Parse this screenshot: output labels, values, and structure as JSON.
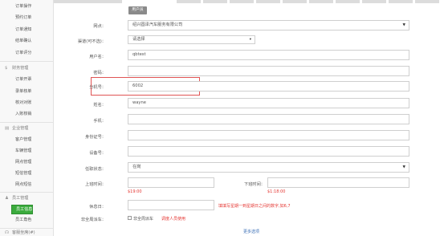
{
  "sidebar": {
    "group1_items": [
      {
        "label": "订单操作"
      },
      {
        "label": "预约订单"
      },
      {
        "label": "订单通知"
      },
      {
        "label": "结单确认"
      },
      {
        "label": "订单评分"
      }
    ],
    "finance": {
      "title": "财务管理",
      "icon": "dollar-icon",
      "items": [
        {
          "label": "订单开票"
        },
        {
          "label": "录单核单"
        },
        {
          "label": "核对对账"
        },
        {
          "label": "入账核销"
        }
      ]
    },
    "company": {
      "title": "企业管理",
      "icon": "building-icon",
      "items": [
        {
          "label": "客户管理"
        },
        {
          "label": "车辆管理"
        },
        {
          "label": "网点管理"
        },
        {
          "label": "短信管理"
        },
        {
          "label": "网点短信"
        }
      ]
    },
    "staff": {
      "title": "员工管理",
      "icon": "user-icon",
      "items": [
        {
          "label": "员工信息",
          "active": true
        },
        {
          "label": "员工角色"
        }
      ]
    },
    "bottom_partial": {
      "title": "客服坐席(#)"
    }
  },
  "header": {
    "button_label": "用户员"
  },
  "form": {
    "branch": {
      "label": "网点：",
      "value": "绍兴圆泽汽车服务有限公司"
    },
    "channel": {
      "label": "渠道(可不选)：",
      "value": "请选择"
    },
    "username": {
      "label": "用户名：",
      "value": "qbtest"
    },
    "password": {
      "label": "密码：",
      "value": ""
    },
    "extension": {
      "label": "分机号：",
      "value": "6002"
    },
    "name": {
      "label": "姓名：",
      "value": "wayne"
    },
    "phone": {
      "label": "手机：",
      "value": ""
    },
    "id_card": {
      "label": "身份证号：",
      "value": ""
    },
    "device": {
      "label": "设备号：",
      "value": ""
    },
    "status": {
      "label": "任职状态：",
      "value": "在岗"
    },
    "shift_start": {
      "label": "上班时间：",
      "value": "",
      "note": "$19:00"
    },
    "shift_end": {
      "label": "下班时间：",
      "value": "",
      "note": "$1:18:00"
    },
    "rest_day": {
      "label": "休息日：",
      "value": "",
      "note": "填填写星期一到星期日之间的数字,如6,7"
    },
    "non_regular": {
      "label": "非全周派车：",
      "checkbox_text": "非全周派车",
      "note": "调度人员使用"
    },
    "more_label": "更多选项"
  },
  "colors": {
    "accent_green": "#3bab3d",
    "highlight_red": "#e05555",
    "note_red": "#e53935"
  }
}
